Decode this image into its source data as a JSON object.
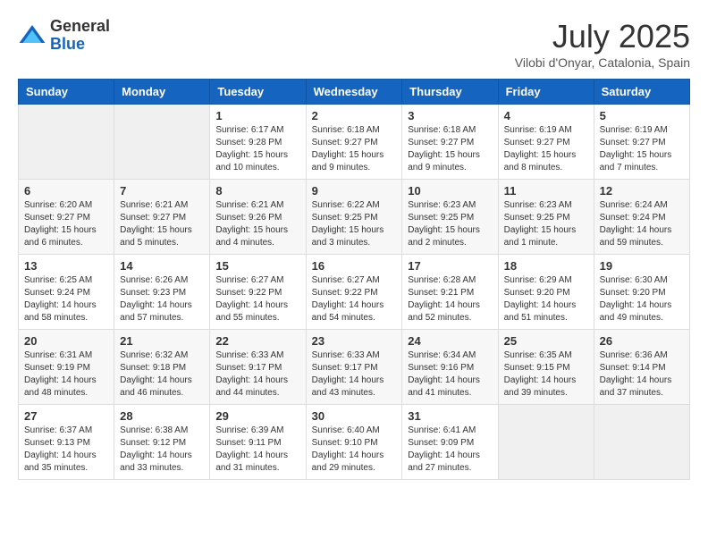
{
  "header": {
    "logo_general": "General",
    "logo_blue": "Blue",
    "month_title": "July 2025",
    "location": "Vilobi d'Onyar, Catalonia, Spain"
  },
  "calendar": {
    "days_of_week": [
      "Sunday",
      "Monday",
      "Tuesday",
      "Wednesday",
      "Thursday",
      "Friday",
      "Saturday"
    ],
    "weeks": [
      [
        {
          "day": "",
          "info": ""
        },
        {
          "day": "",
          "info": ""
        },
        {
          "day": "1",
          "info": "Sunrise: 6:17 AM\nSunset: 9:28 PM\nDaylight: 15 hours and 10 minutes."
        },
        {
          "day": "2",
          "info": "Sunrise: 6:18 AM\nSunset: 9:27 PM\nDaylight: 15 hours and 9 minutes."
        },
        {
          "day": "3",
          "info": "Sunrise: 6:18 AM\nSunset: 9:27 PM\nDaylight: 15 hours and 9 minutes."
        },
        {
          "day": "4",
          "info": "Sunrise: 6:19 AM\nSunset: 9:27 PM\nDaylight: 15 hours and 8 minutes."
        },
        {
          "day": "5",
          "info": "Sunrise: 6:19 AM\nSunset: 9:27 PM\nDaylight: 15 hours and 7 minutes."
        }
      ],
      [
        {
          "day": "6",
          "info": "Sunrise: 6:20 AM\nSunset: 9:27 PM\nDaylight: 15 hours and 6 minutes."
        },
        {
          "day": "7",
          "info": "Sunrise: 6:21 AM\nSunset: 9:27 PM\nDaylight: 15 hours and 5 minutes."
        },
        {
          "day": "8",
          "info": "Sunrise: 6:21 AM\nSunset: 9:26 PM\nDaylight: 15 hours and 4 minutes."
        },
        {
          "day": "9",
          "info": "Sunrise: 6:22 AM\nSunset: 9:25 PM\nDaylight: 15 hours and 3 minutes."
        },
        {
          "day": "10",
          "info": "Sunrise: 6:23 AM\nSunset: 9:25 PM\nDaylight: 15 hours and 2 minutes."
        },
        {
          "day": "11",
          "info": "Sunrise: 6:23 AM\nSunset: 9:25 PM\nDaylight: 15 hours and 1 minute."
        },
        {
          "day": "12",
          "info": "Sunrise: 6:24 AM\nSunset: 9:24 PM\nDaylight: 14 hours and 59 minutes."
        }
      ],
      [
        {
          "day": "13",
          "info": "Sunrise: 6:25 AM\nSunset: 9:24 PM\nDaylight: 14 hours and 58 minutes."
        },
        {
          "day": "14",
          "info": "Sunrise: 6:26 AM\nSunset: 9:23 PM\nDaylight: 14 hours and 57 minutes."
        },
        {
          "day": "15",
          "info": "Sunrise: 6:27 AM\nSunset: 9:22 PM\nDaylight: 14 hours and 55 minutes."
        },
        {
          "day": "16",
          "info": "Sunrise: 6:27 AM\nSunset: 9:22 PM\nDaylight: 14 hours and 54 minutes."
        },
        {
          "day": "17",
          "info": "Sunrise: 6:28 AM\nSunset: 9:21 PM\nDaylight: 14 hours and 52 minutes."
        },
        {
          "day": "18",
          "info": "Sunrise: 6:29 AM\nSunset: 9:20 PM\nDaylight: 14 hours and 51 minutes."
        },
        {
          "day": "19",
          "info": "Sunrise: 6:30 AM\nSunset: 9:20 PM\nDaylight: 14 hours and 49 minutes."
        }
      ],
      [
        {
          "day": "20",
          "info": "Sunrise: 6:31 AM\nSunset: 9:19 PM\nDaylight: 14 hours and 48 minutes."
        },
        {
          "day": "21",
          "info": "Sunrise: 6:32 AM\nSunset: 9:18 PM\nDaylight: 14 hours and 46 minutes."
        },
        {
          "day": "22",
          "info": "Sunrise: 6:33 AM\nSunset: 9:17 PM\nDaylight: 14 hours and 44 minutes."
        },
        {
          "day": "23",
          "info": "Sunrise: 6:33 AM\nSunset: 9:17 PM\nDaylight: 14 hours and 43 minutes."
        },
        {
          "day": "24",
          "info": "Sunrise: 6:34 AM\nSunset: 9:16 PM\nDaylight: 14 hours and 41 minutes."
        },
        {
          "day": "25",
          "info": "Sunrise: 6:35 AM\nSunset: 9:15 PM\nDaylight: 14 hours and 39 minutes."
        },
        {
          "day": "26",
          "info": "Sunrise: 6:36 AM\nSunset: 9:14 PM\nDaylight: 14 hours and 37 minutes."
        }
      ],
      [
        {
          "day": "27",
          "info": "Sunrise: 6:37 AM\nSunset: 9:13 PM\nDaylight: 14 hours and 35 minutes."
        },
        {
          "day": "28",
          "info": "Sunrise: 6:38 AM\nSunset: 9:12 PM\nDaylight: 14 hours and 33 minutes."
        },
        {
          "day": "29",
          "info": "Sunrise: 6:39 AM\nSunset: 9:11 PM\nDaylight: 14 hours and 31 minutes."
        },
        {
          "day": "30",
          "info": "Sunrise: 6:40 AM\nSunset: 9:10 PM\nDaylight: 14 hours and 29 minutes."
        },
        {
          "day": "31",
          "info": "Sunrise: 6:41 AM\nSunset: 9:09 PM\nDaylight: 14 hours and 27 minutes."
        },
        {
          "day": "",
          "info": ""
        },
        {
          "day": "",
          "info": ""
        }
      ]
    ]
  }
}
